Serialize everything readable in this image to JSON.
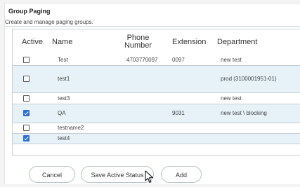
{
  "header": {
    "title": "Group Paging",
    "subtitle": "Create and manage paging groups."
  },
  "table": {
    "columns": [
      "Active",
      "Name",
      "Phone\nNumber",
      "Extension",
      "Department"
    ],
    "columns_split": {
      "active": "Active",
      "name": "Name",
      "phone_line1": "Phone",
      "phone_line2": "Number",
      "extension": "Extension",
      "department": "Department"
    },
    "rows": [
      {
        "active": false,
        "name": "Test",
        "phone": "4703770097",
        "extension": "0097",
        "department": "new test"
      },
      {
        "active": false,
        "name": "test1",
        "phone": "",
        "extension": "",
        "department": "prod (3100001951-01)"
      },
      {
        "active": false,
        "name": "test3",
        "phone": "",
        "extension": "",
        "department": "new test"
      },
      {
        "active": true,
        "name": "QA",
        "phone": "",
        "extension": "9031",
        "department": "new test \\ blocking"
      },
      {
        "active": false,
        "name": "testname2",
        "phone": "",
        "extension": "",
        "department": ""
      },
      {
        "active": true,
        "name": "test4",
        "phone": "",
        "extension": "",
        "department": ""
      }
    ]
  },
  "buttons": {
    "cancel": "Cancel",
    "save_active_status": "Save Active Status",
    "add": "Add"
  },
  "colors": {
    "row_highlight": "#e6f2f8",
    "checkbox_checked": "#2f6fdc"
  },
  "icons": {
    "cursor": "mouse-pointer-icon"
  }
}
